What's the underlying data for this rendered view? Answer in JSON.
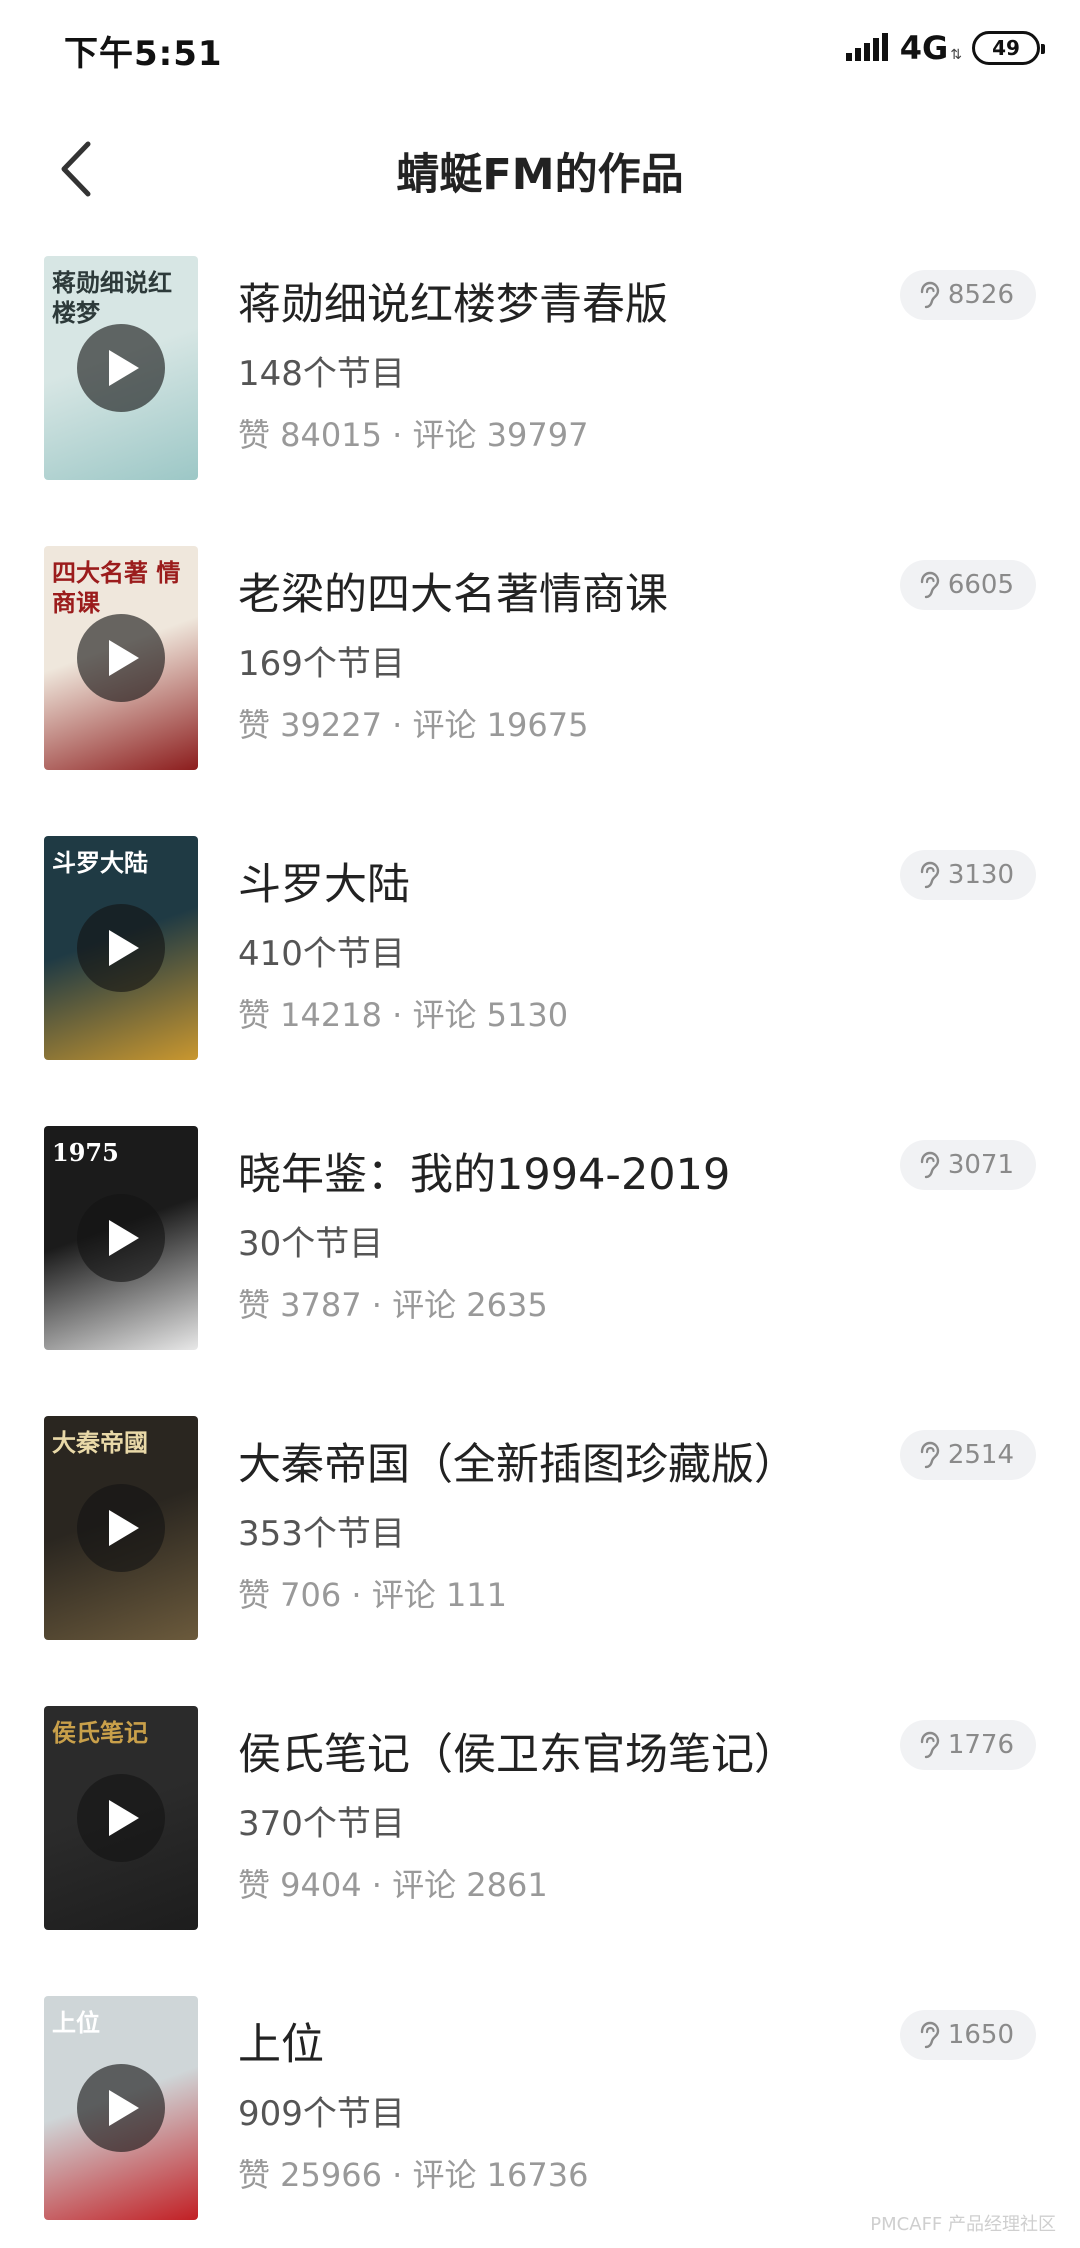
{
  "status_bar": {
    "time": "下午5:51",
    "network": "4G",
    "battery": "49"
  },
  "header": {
    "title": "蜻蜓FM的作品",
    "back_icon": "chevron-left-icon"
  },
  "works": [
    {
      "title": "蒋勋细说红楼梦青春版",
      "episodes": "148个节目",
      "stats": "赞 84015 · 评论 39797",
      "listens": "8526",
      "cover_text": "蒋勋细说红楼梦",
      "cover_colors": [
        "#d7e6e4",
        "#9cc7c6"
      ],
      "cover_text_color": "#2d3a3a"
    },
    {
      "title": "老梁的四大名著情商课",
      "episodes": "169个节目",
      "stats": "赞 39227 · 评论 19675",
      "listens": "6605",
      "cover_text": "四大名著 情商课",
      "cover_colors": [
        "#efe7dc",
        "#8c1d1d"
      ],
      "cover_text_color": "#9b1c1c"
    },
    {
      "title": "斗罗大陆",
      "episodes": "410个节目",
      "stats": "赞 14218 · 评论 5130",
      "listens": "3130",
      "cover_text": "斗罗大陆",
      "cover_colors": [
        "#1f3a44",
        "#c9972f"
      ],
      "cover_text_color": "#ffffff"
    },
    {
      "title": "晓年鉴：我的1994-2019",
      "episodes": "30个节目",
      "stats": "赞 3787 · 评论 2635",
      "listens": "3071",
      "cover_text": "1975",
      "cover_colors": [
        "#1b1b1b",
        "#e8e8e8"
      ],
      "cover_text_color": "#ffffff"
    },
    {
      "title": "大秦帝国（全新插图珍藏版）",
      "episodes": "353个节目",
      "stats": "赞 706 · 评论 111",
      "listens": "2514",
      "cover_text": "大秦帝國",
      "cover_colors": [
        "#2a2620",
        "#6b5a3c"
      ],
      "cover_text_color": "#e9d9a8"
    },
    {
      "title": "侯氏笔记（侯卫东官场笔记）",
      "episodes": "370个节目",
      "stats": "赞 9404 · 评论 2861",
      "listens": "1776",
      "cover_text": "侯氏笔记",
      "cover_colors": [
        "#2b2b2b",
        "#1d1d1d"
      ],
      "cover_text_color": "#c9a04a"
    },
    {
      "title": "上位",
      "episodes": "909个节目",
      "stats": "赞 25966 · 评论 16736",
      "listens": "1650",
      "cover_text": "上位",
      "cover_colors": [
        "#cfd6d8",
        "#c21f24"
      ],
      "cover_text_color": "#ffffff"
    }
  ],
  "watermark": "PMCAFF 产品经理社区"
}
